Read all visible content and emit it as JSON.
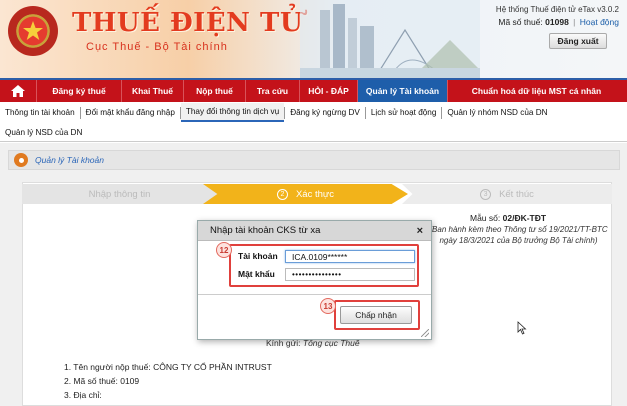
{
  "header": {
    "site_title": "THUẾ ĐIỆN TỬ",
    "site_subtitle": "Cục Thuế - Bộ Tài chính",
    "system_info": "Hệ thống Thuế điện tử eTax v3.0.2",
    "tax_code_label": "Mã số thuế:",
    "tax_code_value": "01098",
    "activity_link": "Hoạt động",
    "logout_label": "Đăng xuất",
    "emblem_text": "CHXHCN VIỆT NAM"
  },
  "main_nav": {
    "items": [
      {
        "label": "Đăng ký thuế"
      },
      {
        "label": "Khai Thuế"
      },
      {
        "label": "Nộp thuế"
      },
      {
        "label": "Tra cứu"
      },
      {
        "label": "HỎI - ĐÁP"
      },
      {
        "label": "Quản lý Tài khoản"
      },
      {
        "label": "Chuẩn hoá dữ liệu MST cá nhân"
      }
    ],
    "active_index": 5
  },
  "sub_nav": {
    "row1": [
      {
        "label": "Thông tin tài khoản"
      },
      {
        "label": "Đổi mật khẩu đăng nhập"
      },
      {
        "label": "Thay đổi thông tin dịch vụ"
      },
      {
        "label": "Đăng ký ngừng DV"
      },
      {
        "label": "Lịch sử hoạt động"
      },
      {
        "label": "Quản lý nhóm NSD của DN"
      }
    ],
    "row2": [
      {
        "label": "Quản lý NSD của DN"
      }
    ],
    "active": "Thay đổi thông tin dịch vụ"
  },
  "section": {
    "title": "Quản lý Tài khoản"
  },
  "stepper": {
    "steps": [
      {
        "num": "",
        "label": "Nhập thông tin"
      },
      {
        "num": "2",
        "label": "Xác thực"
      },
      {
        "num": "3",
        "label": "Kết thúc"
      }
    ],
    "active_index": 1
  },
  "form": {
    "form_no_label": "Mẫu số:",
    "form_no_value": "02/ĐK-TĐT",
    "note": "(Ban hành kèm theo Thông tư số 19/2021/TT-BTC ngày 18/3/2021 của Bộ trưởng Bộ Tài chính)",
    "recipient_label": "Kính gửi:",
    "recipient_value": "Tổng cục Thuế",
    "lines": [
      "1. Tên người nộp thuế: CÔNG TY CỔ PHẦN INTRUST",
      "2. Mã số thuế: 0109",
      "3. Địa chỉ:"
    ]
  },
  "modal": {
    "title": "Nhập tài khoản CKS từ xa",
    "account_label": "Tài khoản",
    "account_value": "ICA.0109******",
    "password_label": "Mật khẩu",
    "password_value": "•••••••••••••••",
    "accept_label": "Chấp nhận",
    "close_symbol": "×"
  },
  "annotations": {
    "callout_fields": "12",
    "callout_button": "13"
  },
  "colors": {
    "nav_red": "#c4121a",
    "nav_active_blue": "#1e5eaa",
    "step_active": "#f2b31a",
    "title_red": "#e33b1f",
    "highlight": "#e0403c"
  }
}
